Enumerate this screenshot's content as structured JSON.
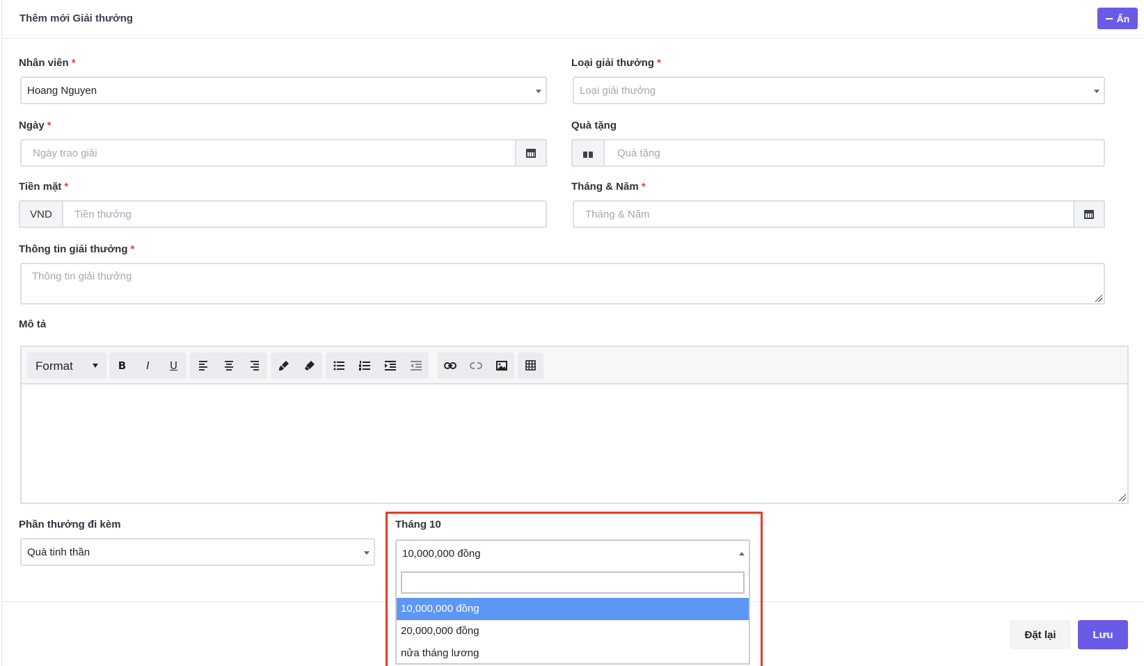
{
  "panel": {
    "title": "Thêm mới Giải thưởng",
    "hide_label": "Ẩn"
  },
  "required_mark": "*",
  "fields": {
    "employee": {
      "label": "Nhân viên",
      "value": "Hoang Nguyen"
    },
    "award_type": {
      "label": "Loại giải thưởng",
      "placeholder": "Loại giải thưởng"
    },
    "date": {
      "label": "Ngày",
      "placeholder": "Ngày trao giải"
    },
    "gift": {
      "label": "Quà tặng",
      "placeholder": "Quà tặng"
    },
    "cash": {
      "label": "Tiền mặt",
      "currency": "VND",
      "placeholder": "Tiền thưởng"
    },
    "month_year": {
      "label": "Tháng & Năm",
      "placeholder": "Tháng & Năm"
    },
    "award_info": {
      "label": "Thông tin giải thưởng",
      "placeholder": "Thông tin giải thưởng"
    },
    "description": {
      "label": "Mô tả"
    },
    "extra_reward": {
      "label": "Phần thưởng đi kèm",
      "value": "Quà tinh thần"
    },
    "month10": {
      "label": "Tháng 10",
      "value": "10,000,000 đồng"
    }
  },
  "editor": {
    "format_label": "Format",
    "bold": "B",
    "italic": "I",
    "underline": "U"
  },
  "dropdown": {
    "search_value": "",
    "options": [
      "10,000,000 đồng",
      "20,000,000 đồng",
      "nửa tháng lương"
    ],
    "selected_index": 0
  },
  "footer": {
    "reset_label": "Đặt lại",
    "save_label": "Lưu"
  },
  "colors": {
    "accent": "#6a5be6",
    "required": "#e5432a",
    "highlight": "#e63a23",
    "selected_option": "#5d97f5"
  }
}
